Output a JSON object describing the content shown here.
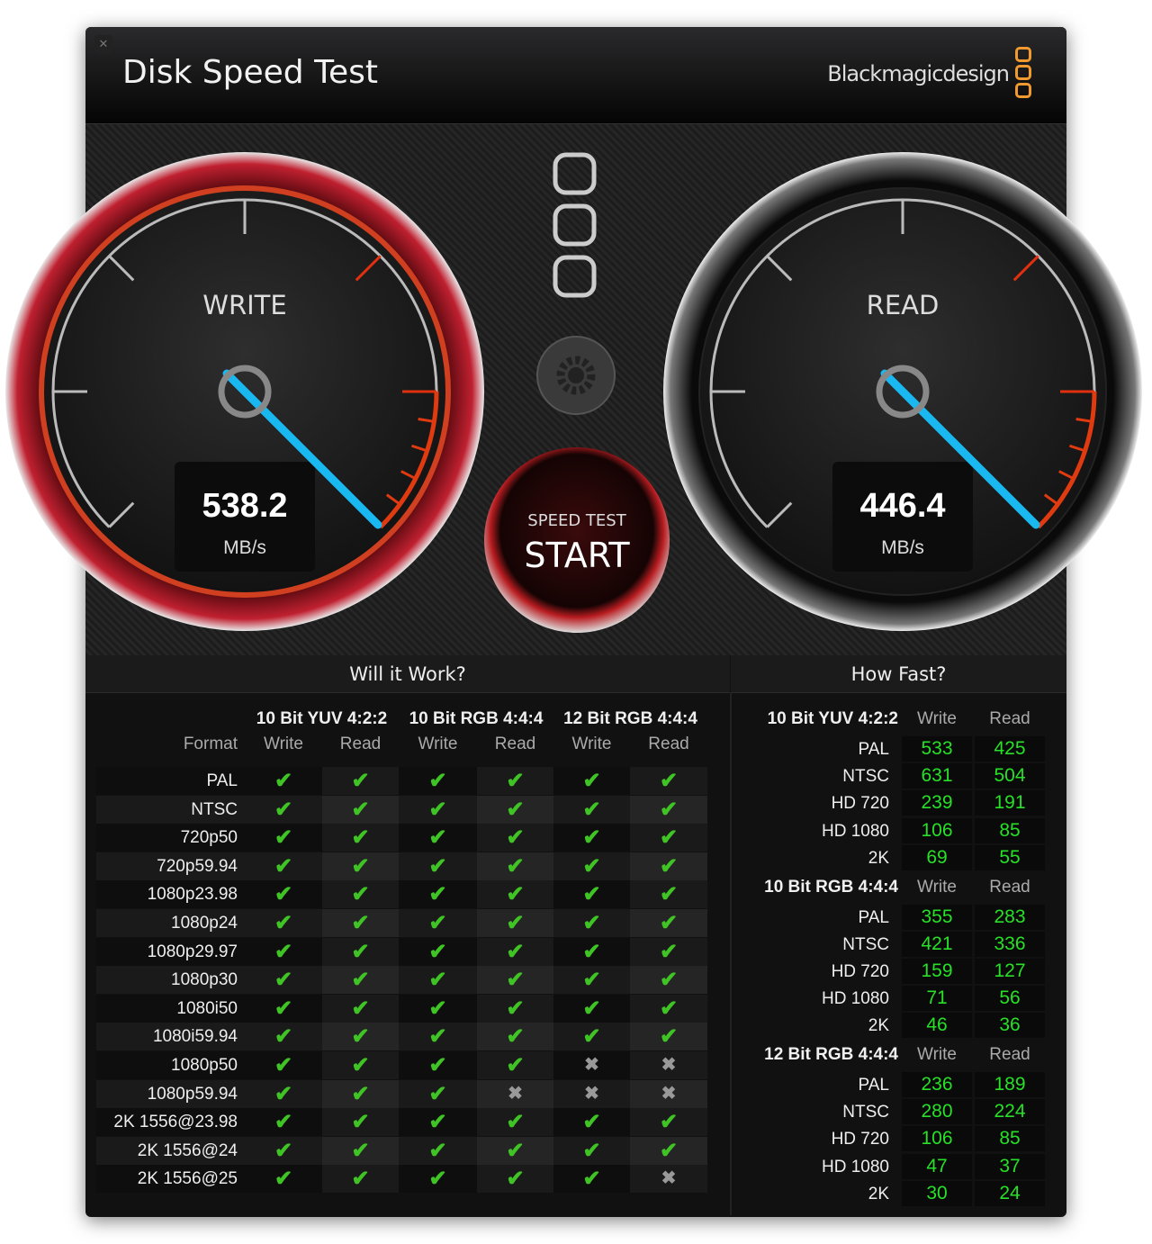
{
  "window": {
    "title": "Disk Speed Test",
    "brand": "Blackmagicdesign",
    "close_icon": "close-icon"
  },
  "gauges": {
    "write": {
      "label": "WRITE",
      "value": "538.2",
      "unit": "MB/s",
      "ring_color": "#c0202a"
    },
    "read": {
      "label": "READ",
      "value": "446.4",
      "unit": "MB/s",
      "ring_color": "#cccccc"
    },
    "needle_color": "#1ab8f0"
  },
  "start_button": {
    "top": "SPEED TEST",
    "main": "START"
  },
  "settings_icon": "gear-icon",
  "will_it_work": {
    "title": "Will it Work?",
    "format_label": "Format",
    "groups": [
      "10 Bit YUV 4:2:2",
      "10 Bit RGB 4:4:4",
      "12 Bit RGB 4:4:4"
    ],
    "subcols": [
      "Write",
      "Read",
      "Write",
      "Read",
      "Write",
      "Read"
    ],
    "rows": [
      {
        "format": "PAL",
        "ok": [
          true,
          true,
          true,
          true,
          true,
          true
        ]
      },
      {
        "format": "NTSC",
        "ok": [
          true,
          true,
          true,
          true,
          true,
          true
        ]
      },
      {
        "format": "720p50",
        "ok": [
          true,
          true,
          true,
          true,
          true,
          true
        ]
      },
      {
        "format": "720p59.94",
        "ok": [
          true,
          true,
          true,
          true,
          true,
          true
        ]
      },
      {
        "format": "1080p23.98",
        "ok": [
          true,
          true,
          true,
          true,
          true,
          true
        ]
      },
      {
        "format": "1080p24",
        "ok": [
          true,
          true,
          true,
          true,
          true,
          true
        ]
      },
      {
        "format": "1080p29.97",
        "ok": [
          true,
          true,
          true,
          true,
          true,
          true
        ]
      },
      {
        "format": "1080p30",
        "ok": [
          true,
          true,
          true,
          true,
          true,
          true
        ]
      },
      {
        "format": "1080i50",
        "ok": [
          true,
          true,
          true,
          true,
          true,
          true
        ]
      },
      {
        "format": "1080i59.94",
        "ok": [
          true,
          true,
          true,
          true,
          true,
          true
        ]
      },
      {
        "format": "1080p50",
        "ok": [
          true,
          true,
          true,
          true,
          false,
          false
        ]
      },
      {
        "format": "1080p59.94",
        "ok": [
          true,
          true,
          true,
          false,
          false,
          false
        ]
      },
      {
        "format": "2K 1556@23.98",
        "ok": [
          true,
          true,
          true,
          true,
          true,
          true
        ]
      },
      {
        "format": "2K 1556@24",
        "ok": [
          true,
          true,
          true,
          true,
          true,
          true
        ]
      },
      {
        "format": "2K 1556@25",
        "ok": [
          true,
          true,
          true,
          true,
          true,
          false
        ]
      }
    ]
  },
  "how_fast": {
    "title": "How Fast?",
    "write_label": "Write",
    "read_label": "Read",
    "groups": [
      {
        "name": "10 Bit YUV 4:2:2",
        "rows": [
          [
            "PAL",
            "533",
            "425"
          ],
          [
            "NTSC",
            "631",
            "504"
          ],
          [
            "HD 720",
            "239",
            "191"
          ],
          [
            "HD 1080",
            "106",
            "85"
          ],
          [
            "2K",
            "69",
            "55"
          ]
        ]
      },
      {
        "name": "10 Bit RGB 4:4:4",
        "rows": [
          [
            "PAL",
            "355",
            "283"
          ],
          [
            "NTSC",
            "421",
            "336"
          ],
          [
            "HD 720",
            "159",
            "127"
          ],
          [
            "HD 1080",
            "71",
            "56"
          ],
          [
            "2K",
            "46",
            "36"
          ]
        ]
      },
      {
        "name": "12 Bit RGB 4:4:4",
        "rows": [
          [
            "PAL",
            "236",
            "189"
          ],
          [
            "NTSC",
            "280",
            "224"
          ],
          [
            "HD 720",
            "106",
            "85"
          ],
          [
            "HD 1080",
            "47",
            "37"
          ],
          [
            "2K",
            "30",
            "24"
          ]
        ]
      }
    ]
  }
}
